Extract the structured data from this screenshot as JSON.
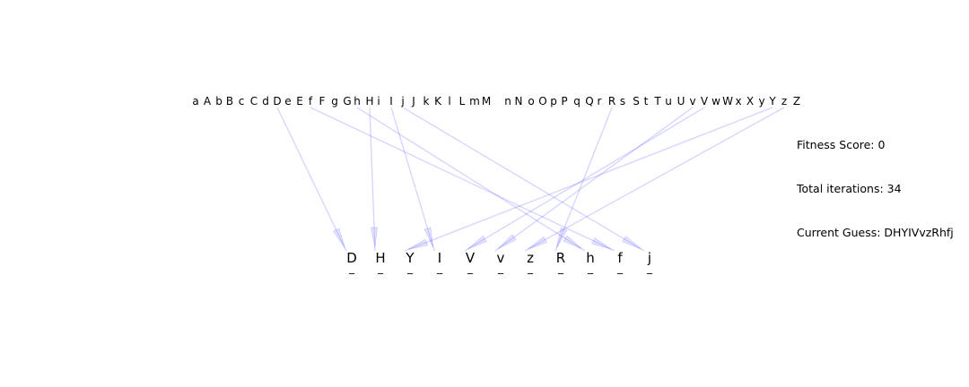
{
  "alphabet": [
    "a",
    "A",
    "b",
    "B",
    "c",
    "C",
    "d",
    "D",
    "e",
    "E",
    "f",
    "F",
    "g",
    "G",
    "h",
    "H",
    "i",
    "I",
    "j",
    "J",
    "k",
    "K",
    "l",
    "L",
    "m",
    "M",
    "n",
    "N",
    "o",
    "O",
    "p",
    "P",
    "q",
    "Q",
    "r",
    "R",
    "s",
    "S",
    "t",
    "T",
    "u",
    "U",
    "v",
    "V",
    "w",
    "W",
    "x",
    "X",
    "y",
    "Y",
    "z",
    "Z"
  ],
  "guess_letters": [
    "D",
    "H",
    "Y",
    "I",
    "V",
    "v",
    "z",
    "R",
    "h",
    "f",
    "j"
  ],
  "guess_placeholder": "_",
  "info": {
    "fitness": "Fitness Score: 0",
    "iterations": "Total iterations: 34",
    "guess": "Current Guess: DHYIVvzRhfj"
  },
  "colors": {
    "link": "#3b3bff",
    "text": "#000000"
  }
}
